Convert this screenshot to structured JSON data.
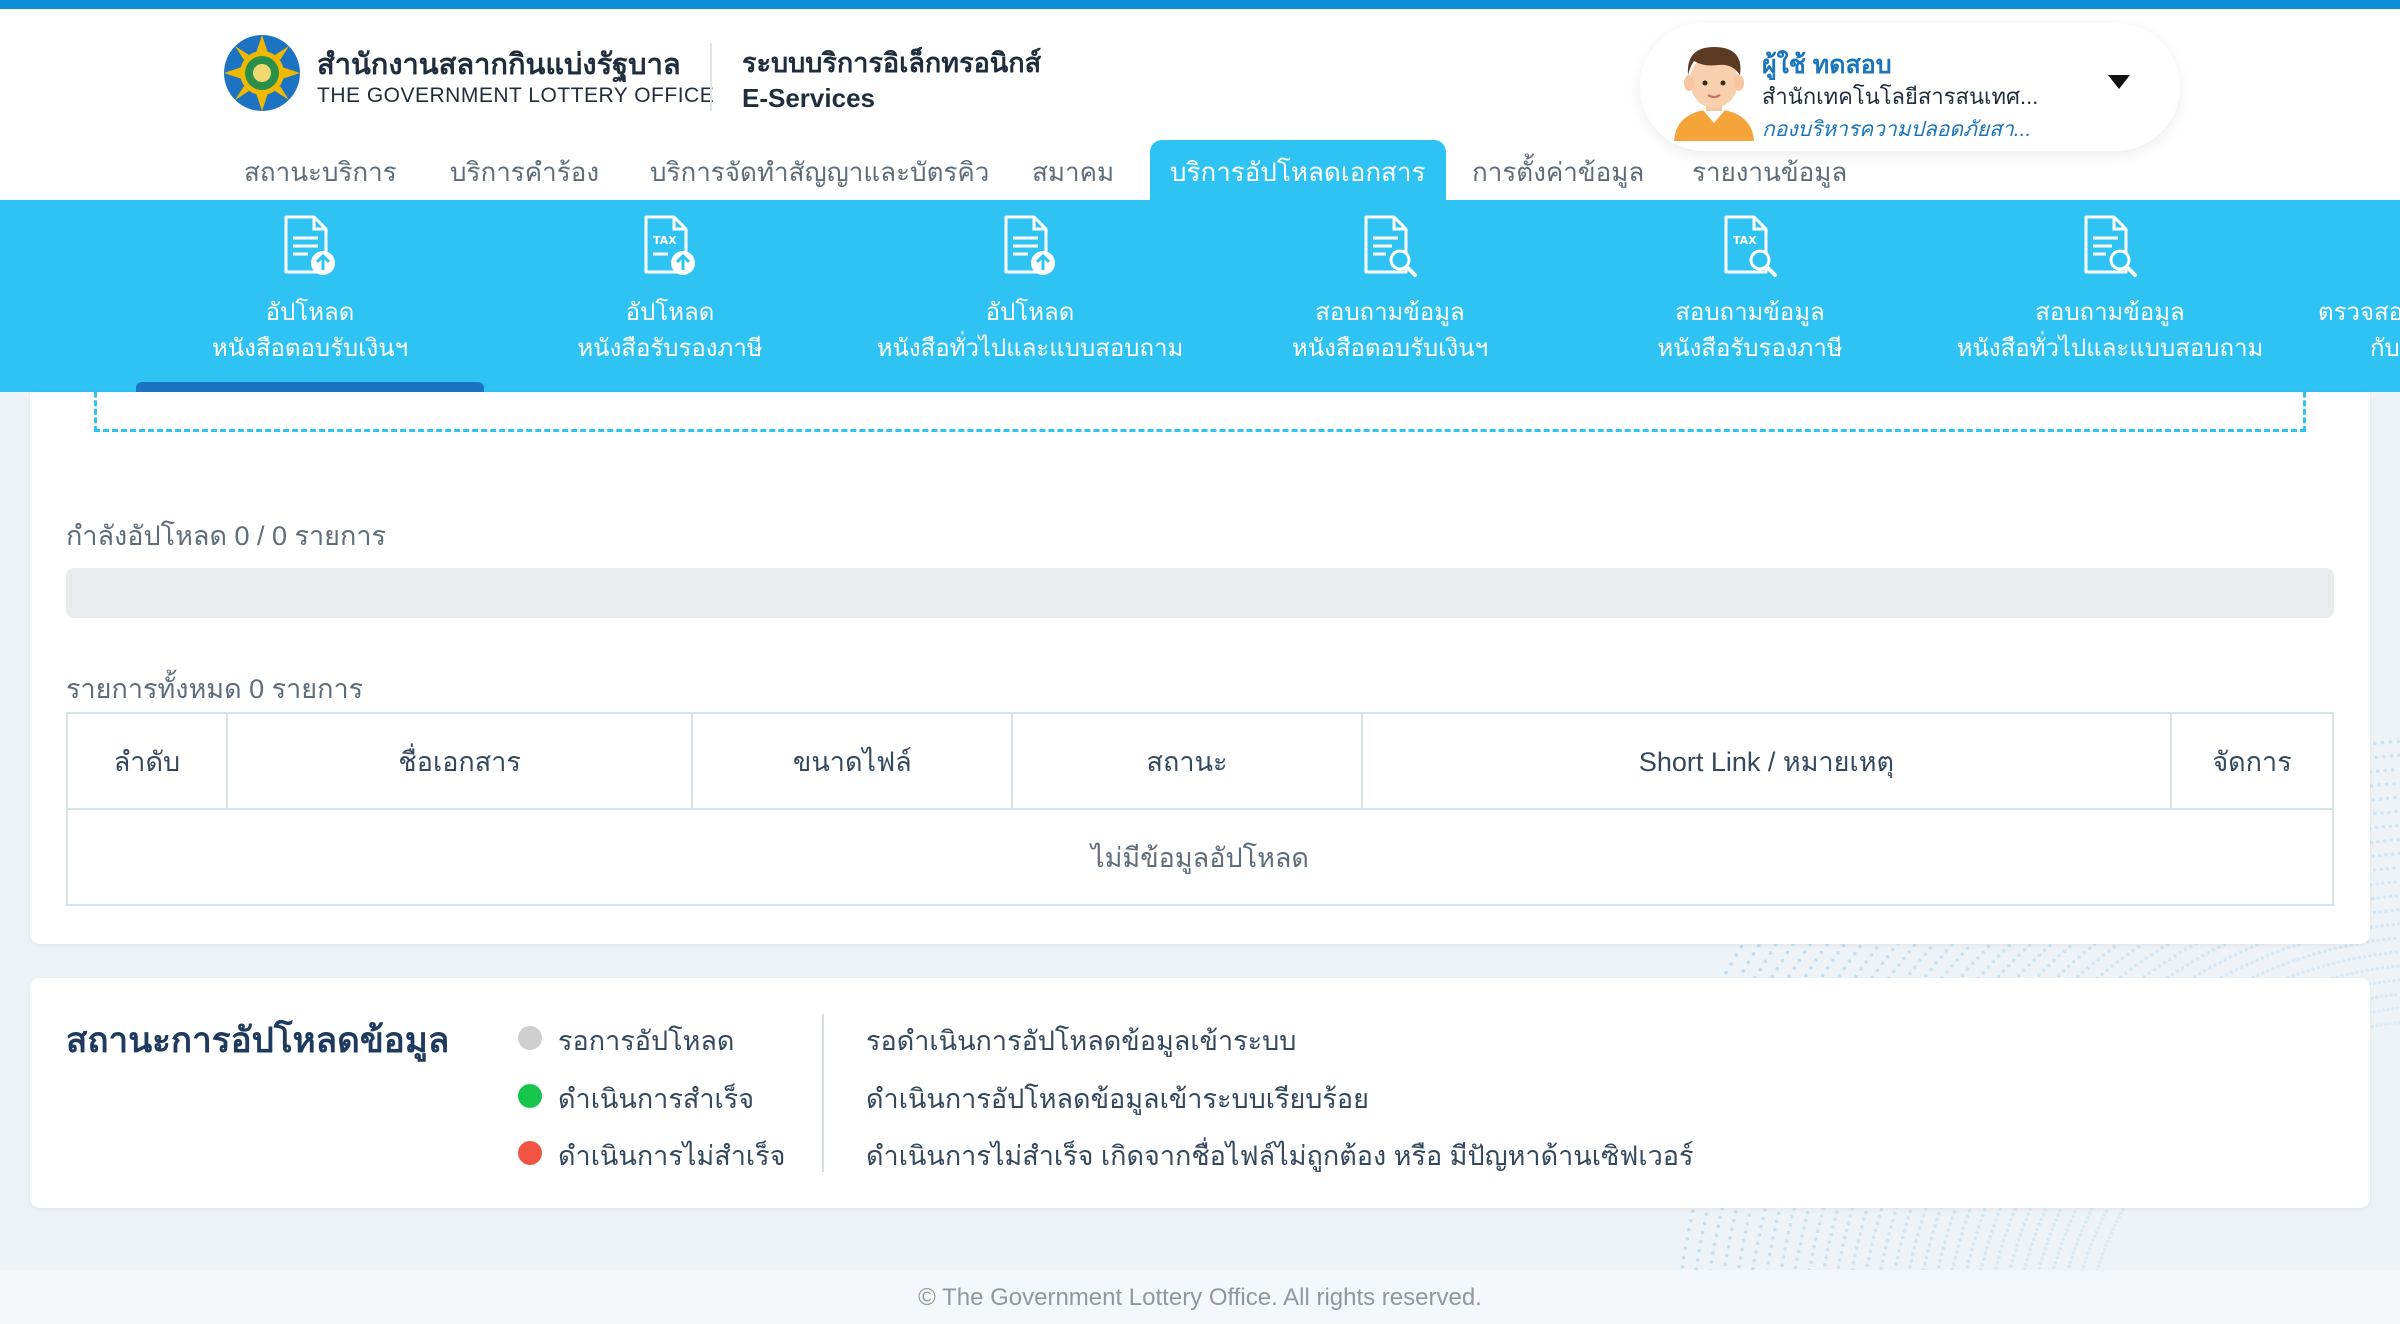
{
  "app": {
    "org_name_th": "สำนักงานสลากกินแบ่งรัฐบาล",
    "org_name_en": "THE GOVERNMENT LOTTERY OFFICE",
    "system_name_th": "ระบบบริการอิเล็กทรอนิกส์",
    "system_name_en": "E-Services"
  },
  "user": {
    "name": "ผู้ใช้ ทดสอบ",
    "department": "สำนักเทคโนโลยีสารสนเทศ...",
    "division": "กองบริหารความปลอดภัยสา..."
  },
  "nav": {
    "items": [
      {
        "label": "สถานะบริการ"
      },
      {
        "label": "บริการคำร้อง"
      },
      {
        "label": "บริการจัดทำสัญญาและบัตรคิว"
      },
      {
        "label": "สมาคม"
      },
      {
        "label": "บริการอัปโหลดเอกสาร",
        "active": true
      },
      {
        "label": "การตั้งค่าข้อมูล"
      },
      {
        "label": "รายงานข้อมูล"
      }
    ]
  },
  "submenu": {
    "items": [
      {
        "line1": "อัปโหลด",
        "line2": "หนังสือตอบรับเงินฯ",
        "icon": "document-upload-icon"
      },
      {
        "line1": "อัปโหลด",
        "line2": "หนังสือรับรองภาษี",
        "icon": "tax-document-upload-icon"
      },
      {
        "line1": "อัปโหลด",
        "line2": "หนังสือทั่วไปและแบบสอบถาม",
        "icon": "document-upload-icon"
      },
      {
        "line1": "สอบถามข้อมูล",
        "line2": "หนังสือตอบรับเงินฯ",
        "icon": "document-search-icon"
      },
      {
        "line1": "สอบถามข้อมูล",
        "line2": "หนังสือรับรองภาษี",
        "icon": "tax-document-search-icon"
      },
      {
        "line1": "สอบถามข้อมูล",
        "line2": "หนังสือทั่วไปและแบบสอบถาม",
        "icon": "document-search-icon"
      },
      {
        "line1": "ตรวจสอ",
        "line2": "กับ",
        "icon": "none"
      }
    ]
  },
  "upload": {
    "progress_label": "กำลังอัปโหลด 0 / 0 รายการ",
    "progress_fraction": 0,
    "total_label": "รายการทั้งหมด 0 รายการ"
  },
  "table": {
    "headers": [
      "ลำดับ",
      "ชื่อเอกสาร",
      "ขนาดไฟล์",
      "สถานะ",
      "Short Link / หมายเหตุ",
      "จัดการ"
    ],
    "empty_text": "ไม่มีข้อมูลอัปโหลด"
  },
  "status_legend": {
    "title": "สถานะการอัปโหลดข้อมูล",
    "items": [
      {
        "label": "รอการอัปโหลด",
        "color": "#cfcfcf",
        "description": "รอดำเนินการอัปโหลดข้อมูลเข้าระบบ"
      },
      {
        "label": "ดำเนินการสำเร็จ",
        "color": "#18c44a",
        "description": "ดำเนินการอัปโหลดข้อมูลเข้าระบบเรียบร้อย"
      },
      {
        "label": "ดำเนินการไม่สำเร็จ",
        "color": "#f25444",
        "description": "ดำเนินการไม่สำเร็จ เกิดจากชื่อไฟล์ไม่ถูกต้อง หรือ มีปัญหาด้านเซิฟเวอร์"
      }
    ]
  },
  "footer": {
    "text": "© The Government Lottery Office. All rights reserved."
  },
  "colors": {
    "accent": "#2ec3f3",
    "primary_dark": "#1b73c2",
    "top_strip": "#0d8fd8"
  }
}
